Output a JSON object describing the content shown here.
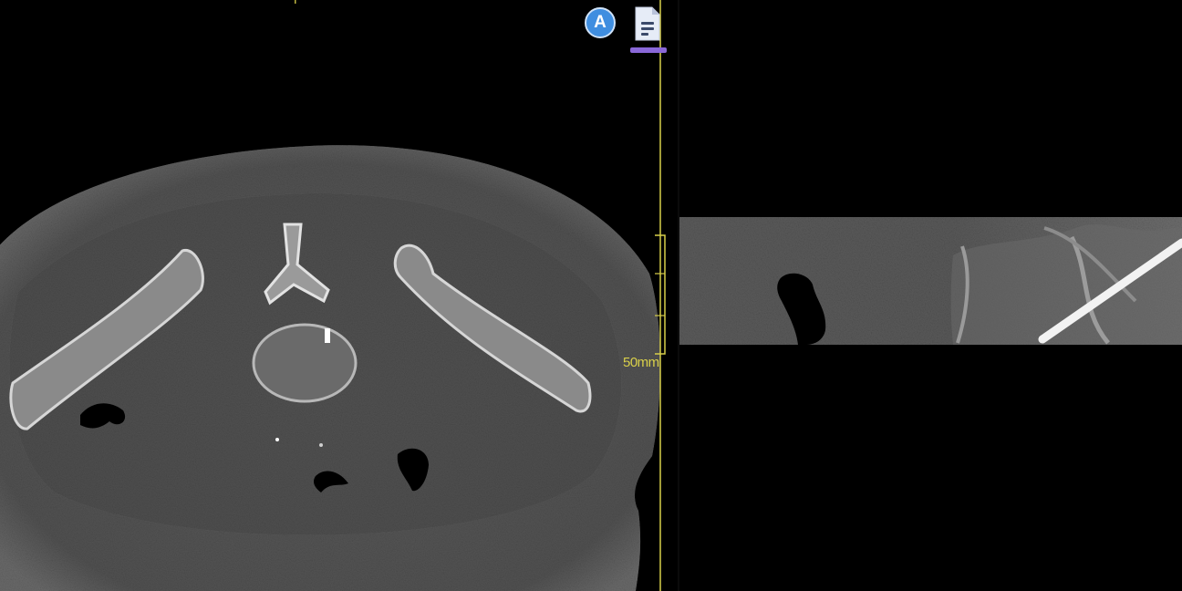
{
  "viewports": {
    "left": {
      "orientation_label": "P",
      "annotation_badge": "A",
      "report_icon": "document-icon",
      "scale_label": "50mm"
    },
    "right": {}
  },
  "colors": {
    "overlay_yellow": "#d8cf4a",
    "badge_blue": "#3f8ee0",
    "report_bar_purple": "#8a68d8",
    "background": "#000000"
  }
}
